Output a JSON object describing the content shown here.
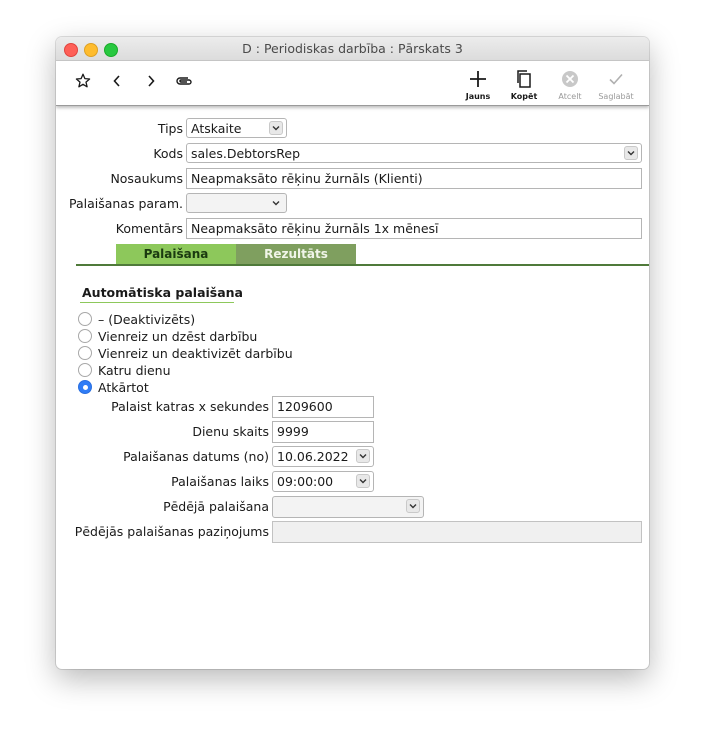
{
  "window": {
    "title": "D : Periodiskas darbība : Pārskats 3"
  },
  "toolbar": {
    "star_icon": "star-icon",
    "back_icon": "chevron-left-icon",
    "forward_icon": "chevron-right-icon",
    "attach_icon": "paperclip-icon",
    "new_label": "Jauns",
    "copy_label": "Kopēt",
    "cancel_label": "Atcelt",
    "save_label": "Saglabāt"
  },
  "form": {
    "tips_label": "Tips",
    "tips_value": "Atskaite",
    "kods_label": "Kods",
    "kods_value": "sales.DebtorsRep",
    "nosaukums_label": "Nosaukums",
    "nosaukums_value": "Neapmaksāto rēķinu žurnāls (Klienti)",
    "param_label": "Palaišanas param.",
    "param_value": "",
    "komentars_label": "Komentārs",
    "komentars_value": "Neapmaksāto rēķinu žurnāls 1x mēnesī"
  },
  "tabs": {
    "run": "Palaišana",
    "result": "Rezultāts"
  },
  "auto_run": {
    "section_title": "Automātiska palaišana",
    "options": [
      {
        "label": "– (Deaktivizēts)",
        "checked": false
      },
      {
        "label": "Vienreiz un dzēst darbību",
        "checked": false
      },
      {
        "label": "Vienreiz un deaktivizēt darbību",
        "checked": false
      },
      {
        "label": "Katru dienu",
        "checked": false
      },
      {
        "label": "Atkārtot",
        "checked": true
      }
    ],
    "every_label": "Palaist katras x sekundes",
    "every_value": "1209600",
    "days_label": "Dienu skaits",
    "days_value": "9999",
    "date_label": "Palaišanas datums (no)",
    "date_value": "10.06.2022",
    "time_label": "Palaišanas laiks",
    "time_value": "09:00:00",
    "last_run_label": "Pēdējā palaišana",
    "last_run_value": "",
    "last_msg_label": "Pēdējās palaišanas paziņojums",
    "last_msg_value": ""
  },
  "colors": {
    "accent_green": "#8dc85b",
    "tab_inactive": "#7f9f5f",
    "radio_blue": "#2f7cf6"
  }
}
